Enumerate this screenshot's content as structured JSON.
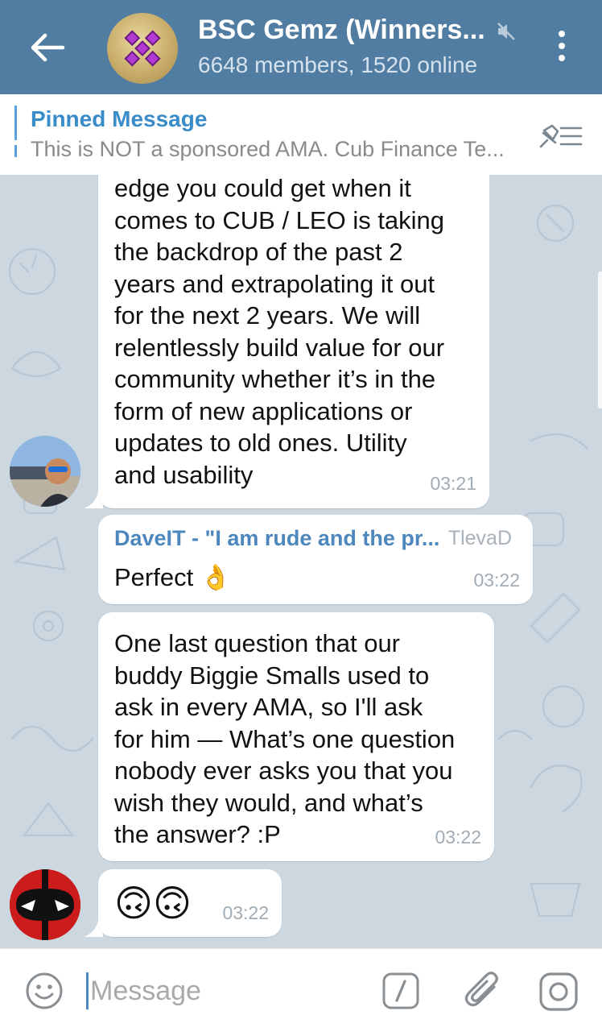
{
  "header": {
    "title": "BSC Gemz (Winners...",
    "subtitle": "6648 members, 1520 online",
    "back_icon": "arrow-left-icon",
    "mute_icon": "muted-speaker-icon",
    "menu_icon": "more-vertical-icon",
    "bg_color": "#517da2"
  },
  "pinned": {
    "label": "Pinned Message",
    "text": "This is NOT a sponsored AMA. Cub Finance Te...",
    "icon": "pinned-list-icon"
  },
  "messages": [
    {
      "text": "edge you could get when it\ncomes to CUB / LEO is taking\nthe backdrop of the past 2\nyears and extrapolating it out\nfor the next 2 years. We will\nrelentlessly build value for our\ncommunity whether it’s in the\nform of new applications or\nupdates to old ones. Utility\nand usability",
      "time": "03:21"
    },
    {
      "sender": "DaveIT - \"I am rude and the pr...",
      "sender_tag": "TlevaD",
      "text": "Perfect 👌",
      "time": "03:22"
    },
    {
      "text": "One last question that our\nbuddy Biggie Smalls used to\nask in every AMA, so I'll ask\nfor him — What’s one question\nnobody ever asks you that you\nwish they would, and what’s\nthe answer? :P",
      "time": "03:22"
    },
    {
      "text": "🙃🙃",
      "time": "03:22"
    }
  ],
  "input": {
    "placeholder": "Message",
    "emoji_icon": "smile-icon",
    "command_icon": "slash-command-icon",
    "attach_icon": "paperclip-icon",
    "camera_icon": "instagram-camera-icon"
  },
  "colors": {
    "accent": "#4e87be",
    "chat_bg": "#ccd7e0",
    "link": "#3a8cc9"
  }
}
